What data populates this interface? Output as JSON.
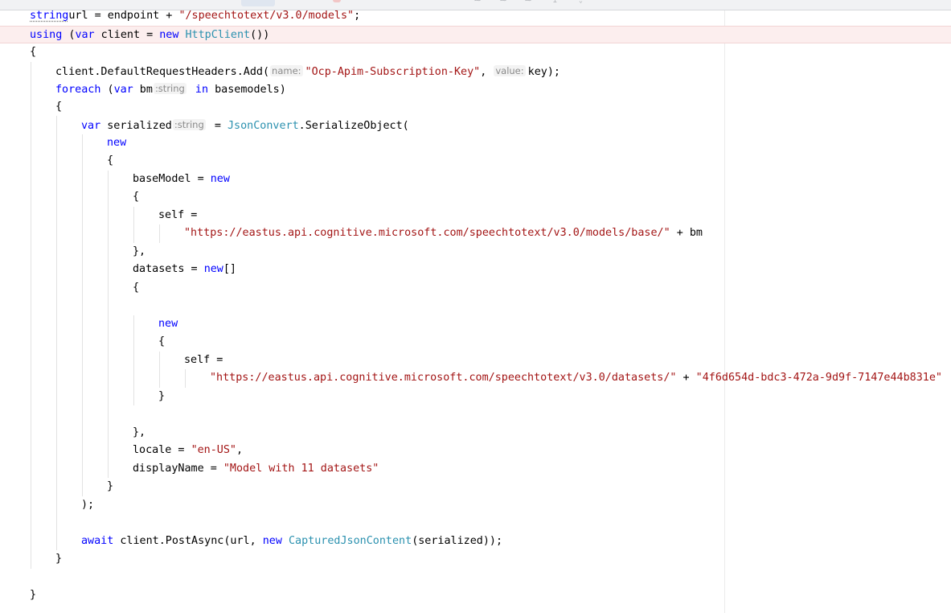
{
  "editor": {
    "colors": {
      "keyword": "#0000ff",
      "type": "#2b91af",
      "string": "#a31515",
      "default": "#000000",
      "hint": "#8a8a8a",
      "current_line": "#fceeee"
    },
    "lines": [
      {
        "indent": 0,
        "tokens": [
          [
            "kw",
            "string"
          ],
          [
            "",
            "url = endpoint + "
          ],
          [
            "str",
            "\"/speechtotext/v3.0/models\""
          ],
          [
            "",
            ";"
          ]
        ]
      },
      {
        "indent": 0,
        "highlight": true,
        "tokens": [
          [
            "kw",
            "using"
          ],
          [
            "",
            " ("
          ],
          [
            "kw",
            "var"
          ],
          [
            "",
            " client = "
          ],
          [
            "kw",
            "new"
          ],
          [
            "",
            " "
          ],
          [
            "ty",
            "HttpClient"
          ],
          [
            "",
            "())"
          ]
        ]
      },
      {
        "indent": 0,
        "tokens": [
          [
            "",
            "{"
          ]
        ]
      },
      {
        "indent": 1,
        "tokens": [
          [
            "",
            "client.DefaultRequestHeaders.Add("
          ],
          [
            "hint",
            "name:"
          ],
          [
            "str",
            "\"Ocp-Apim-Subscription-Key\""
          ],
          [
            "",
            ", "
          ],
          [
            "hint",
            "value:"
          ],
          [
            "",
            "key);"
          ]
        ]
      },
      {
        "indent": 1,
        "tokens": [
          [
            "kw",
            "foreach"
          ],
          [
            "",
            " ("
          ],
          [
            "kw",
            "var"
          ],
          [
            "",
            " bm"
          ],
          [
            "hint",
            ":string"
          ],
          [
            "",
            " "
          ],
          [
            "kw",
            "in"
          ],
          [
            "",
            " basemodels)"
          ]
        ]
      },
      {
        "indent": 1,
        "tokens": [
          [
            "",
            "{"
          ]
        ]
      },
      {
        "indent": 2,
        "tokens": [
          [
            "kw",
            "var"
          ],
          [
            "",
            " serialized"
          ],
          [
            "hint",
            ":string"
          ],
          [
            "",
            " = "
          ],
          [
            "ty",
            "JsonConvert"
          ],
          [
            "",
            ".SerializeObject("
          ]
        ]
      },
      {
        "indent": 3,
        "tokens": [
          [
            "kw",
            "new"
          ]
        ]
      },
      {
        "indent": 3,
        "tokens": [
          [
            "",
            "{"
          ]
        ]
      },
      {
        "indent": 4,
        "tokens": [
          [
            "",
            "baseModel = "
          ],
          [
            "kw",
            "new"
          ]
        ]
      },
      {
        "indent": 4,
        "tokens": [
          [
            "",
            "{"
          ]
        ]
      },
      {
        "indent": 5,
        "tokens": [
          [
            "",
            "self ="
          ]
        ]
      },
      {
        "indent": 6,
        "tokens": [
          [
            "str",
            "\"https://eastus.api.cognitive.microsoft.com/speechtotext/v3.0/models/base/\""
          ],
          [
            "",
            " + bm"
          ]
        ]
      },
      {
        "indent": 4,
        "tokens": [
          [
            "",
            "},"
          ]
        ]
      },
      {
        "indent": 4,
        "tokens": [
          [
            "",
            "datasets = "
          ],
          [
            "kw",
            "new"
          ],
          [
            "",
            "[]"
          ]
        ]
      },
      {
        "indent": 4,
        "tokens": [
          [
            "",
            "{"
          ]
        ]
      },
      {
        "indent": 4,
        "tokens": []
      },
      {
        "indent": 5,
        "tokens": [
          [
            "kw",
            "new"
          ]
        ]
      },
      {
        "indent": 5,
        "tokens": [
          [
            "",
            "{"
          ]
        ]
      },
      {
        "indent": 6,
        "tokens": [
          [
            "",
            "self ="
          ]
        ]
      },
      {
        "indent": 7,
        "tokens": [
          [
            "str",
            "\"https://eastus.api.cognitive.microsoft.com/speechtotext/v3.0/datasets/\""
          ],
          [
            "",
            " + "
          ],
          [
            "str",
            "\"4f6d654d-bdc3-472a-9d9f-7147e44b831e\""
          ]
        ]
      },
      {
        "indent": 5,
        "tokens": [
          [
            "",
            "}"
          ]
        ]
      },
      {
        "indent": 4,
        "tokens": []
      },
      {
        "indent": 4,
        "tokens": [
          [
            "",
            "},"
          ]
        ]
      },
      {
        "indent": 4,
        "tokens": [
          [
            "",
            "locale = "
          ],
          [
            "str",
            "\"en-US\""
          ],
          [
            "",
            ","
          ]
        ]
      },
      {
        "indent": 4,
        "tokens": [
          [
            "",
            "displayName = "
          ],
          [
            "str",
            "\"Model with 11 datasets\""
          ]
        ]
      },
      {
        "indent": 3,
        "tokens": [
          [
            "",
            "}"
          ]
        ]
      },
      {
        "indent": 2,
        "tokens": [
          [
            "",
            ");"
          ]
        ]
      },
      {
        "indent": 2,
        "tokens": []
      },
      {
        "indent": 2,
        "tokens": [
          [
            "kw",
            "await"
          ],
          [
            "",
            " client.PostAsync(url, "
          ],
          [
            "kw",
            "new"
          ],
          [
            "",
            " "
          ],
          [
            "ty",
            "CapturedJsonContent"
          ],
          [
            "",
            "(serialized));"
          ]
        ]
      },
      {
        "indent": 1,
        "tokens": [
          [
            "",
            "}"
          ]
        ]
      },
      {
        "indent": 0,
        "tokens": []
      },
      {
        "indent": 0,
        "tokens": [
          [
            "",
            "}"
          ]
        ]
      }
    ]
  }
}
